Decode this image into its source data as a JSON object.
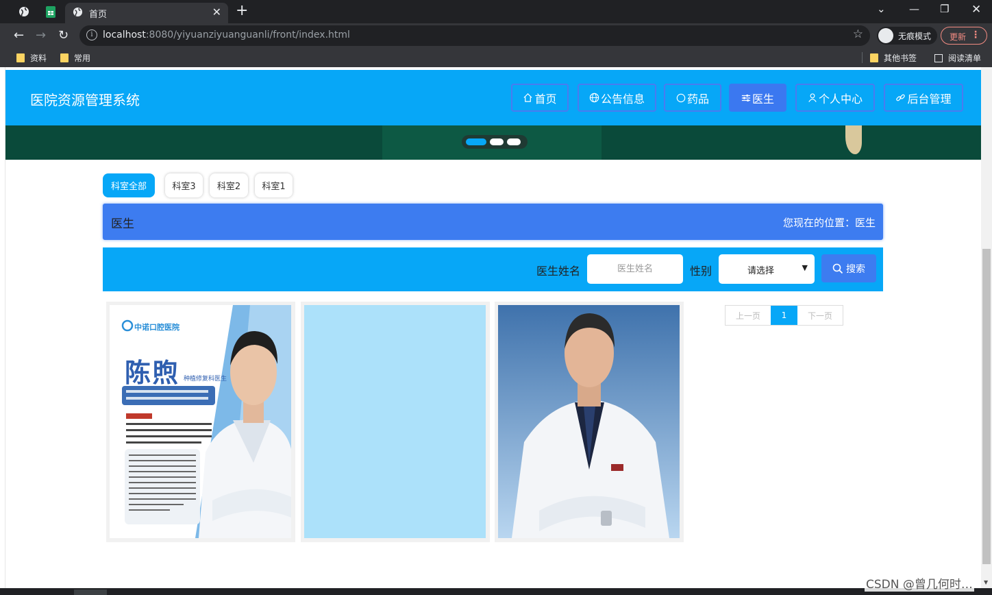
{
  "browser": {
    "active_tab_title": "首页",
    "url_host": "localhost",
    "url_rest": ":8080/yiyuanziyuanguanli/front/index.html",
    "incognito_label": "无痕模式",
    "update_label": "更新",
    "bookmarks": [
      "资料",
      "常用"
    ],
    "bookmarks_right": [
      "其他书签",
      "阅读清单"
    ]
  },
  "header": {
    "site_title": "医院资源管理系统",
    "nav": [
      {
        "label": "首页",
        "icon": "home-icon"
      },
      {
        "label": "公告信息",
        "icon": "globe-icon"
      },
      {
        "label": "药品",
        "icon": "circle-icon"
      },
      {
        "label": "医生",
        "icon": "sliders-icon",
        "active": true
      },
      {
        "label": "个人中心",
        "icon": "user-icon"
      },
      {
        "label": "后台管理",
        "icon": "link-icon"
      }
    ]
  },
  "categories": [
    "科室全部",
    "科室3",
    "科室2",
    "科室1"
  ],
  "title_bar": {
    "title": "医生",
    "location": "您现在的位置：医生"
  },
  "search": {
    "name_label": "医生姓名",
    "name_placeholder": "医生姓名",
    "gender_label": "性别",
    "gender_selected": "请选择",
    "button_label": "搜索"
  },
  "doctor_cards": [
    {
      "hospital": "中诺口腔医院",
      "name": "陈煦",
      "title": "种植修复科医生"
    },
    {},
    {}
  ],
  "pagination": {
    "prev": "上一页",
    "current": "1",
    "next": "下一页"
  },
  "watermark": "CSDN @曾几何时…",
  "colors": {
    "primary": "#07a7f7",
    "accent": "#3d7cf0",
    "banner": "#0a4a3a"
  }
}
